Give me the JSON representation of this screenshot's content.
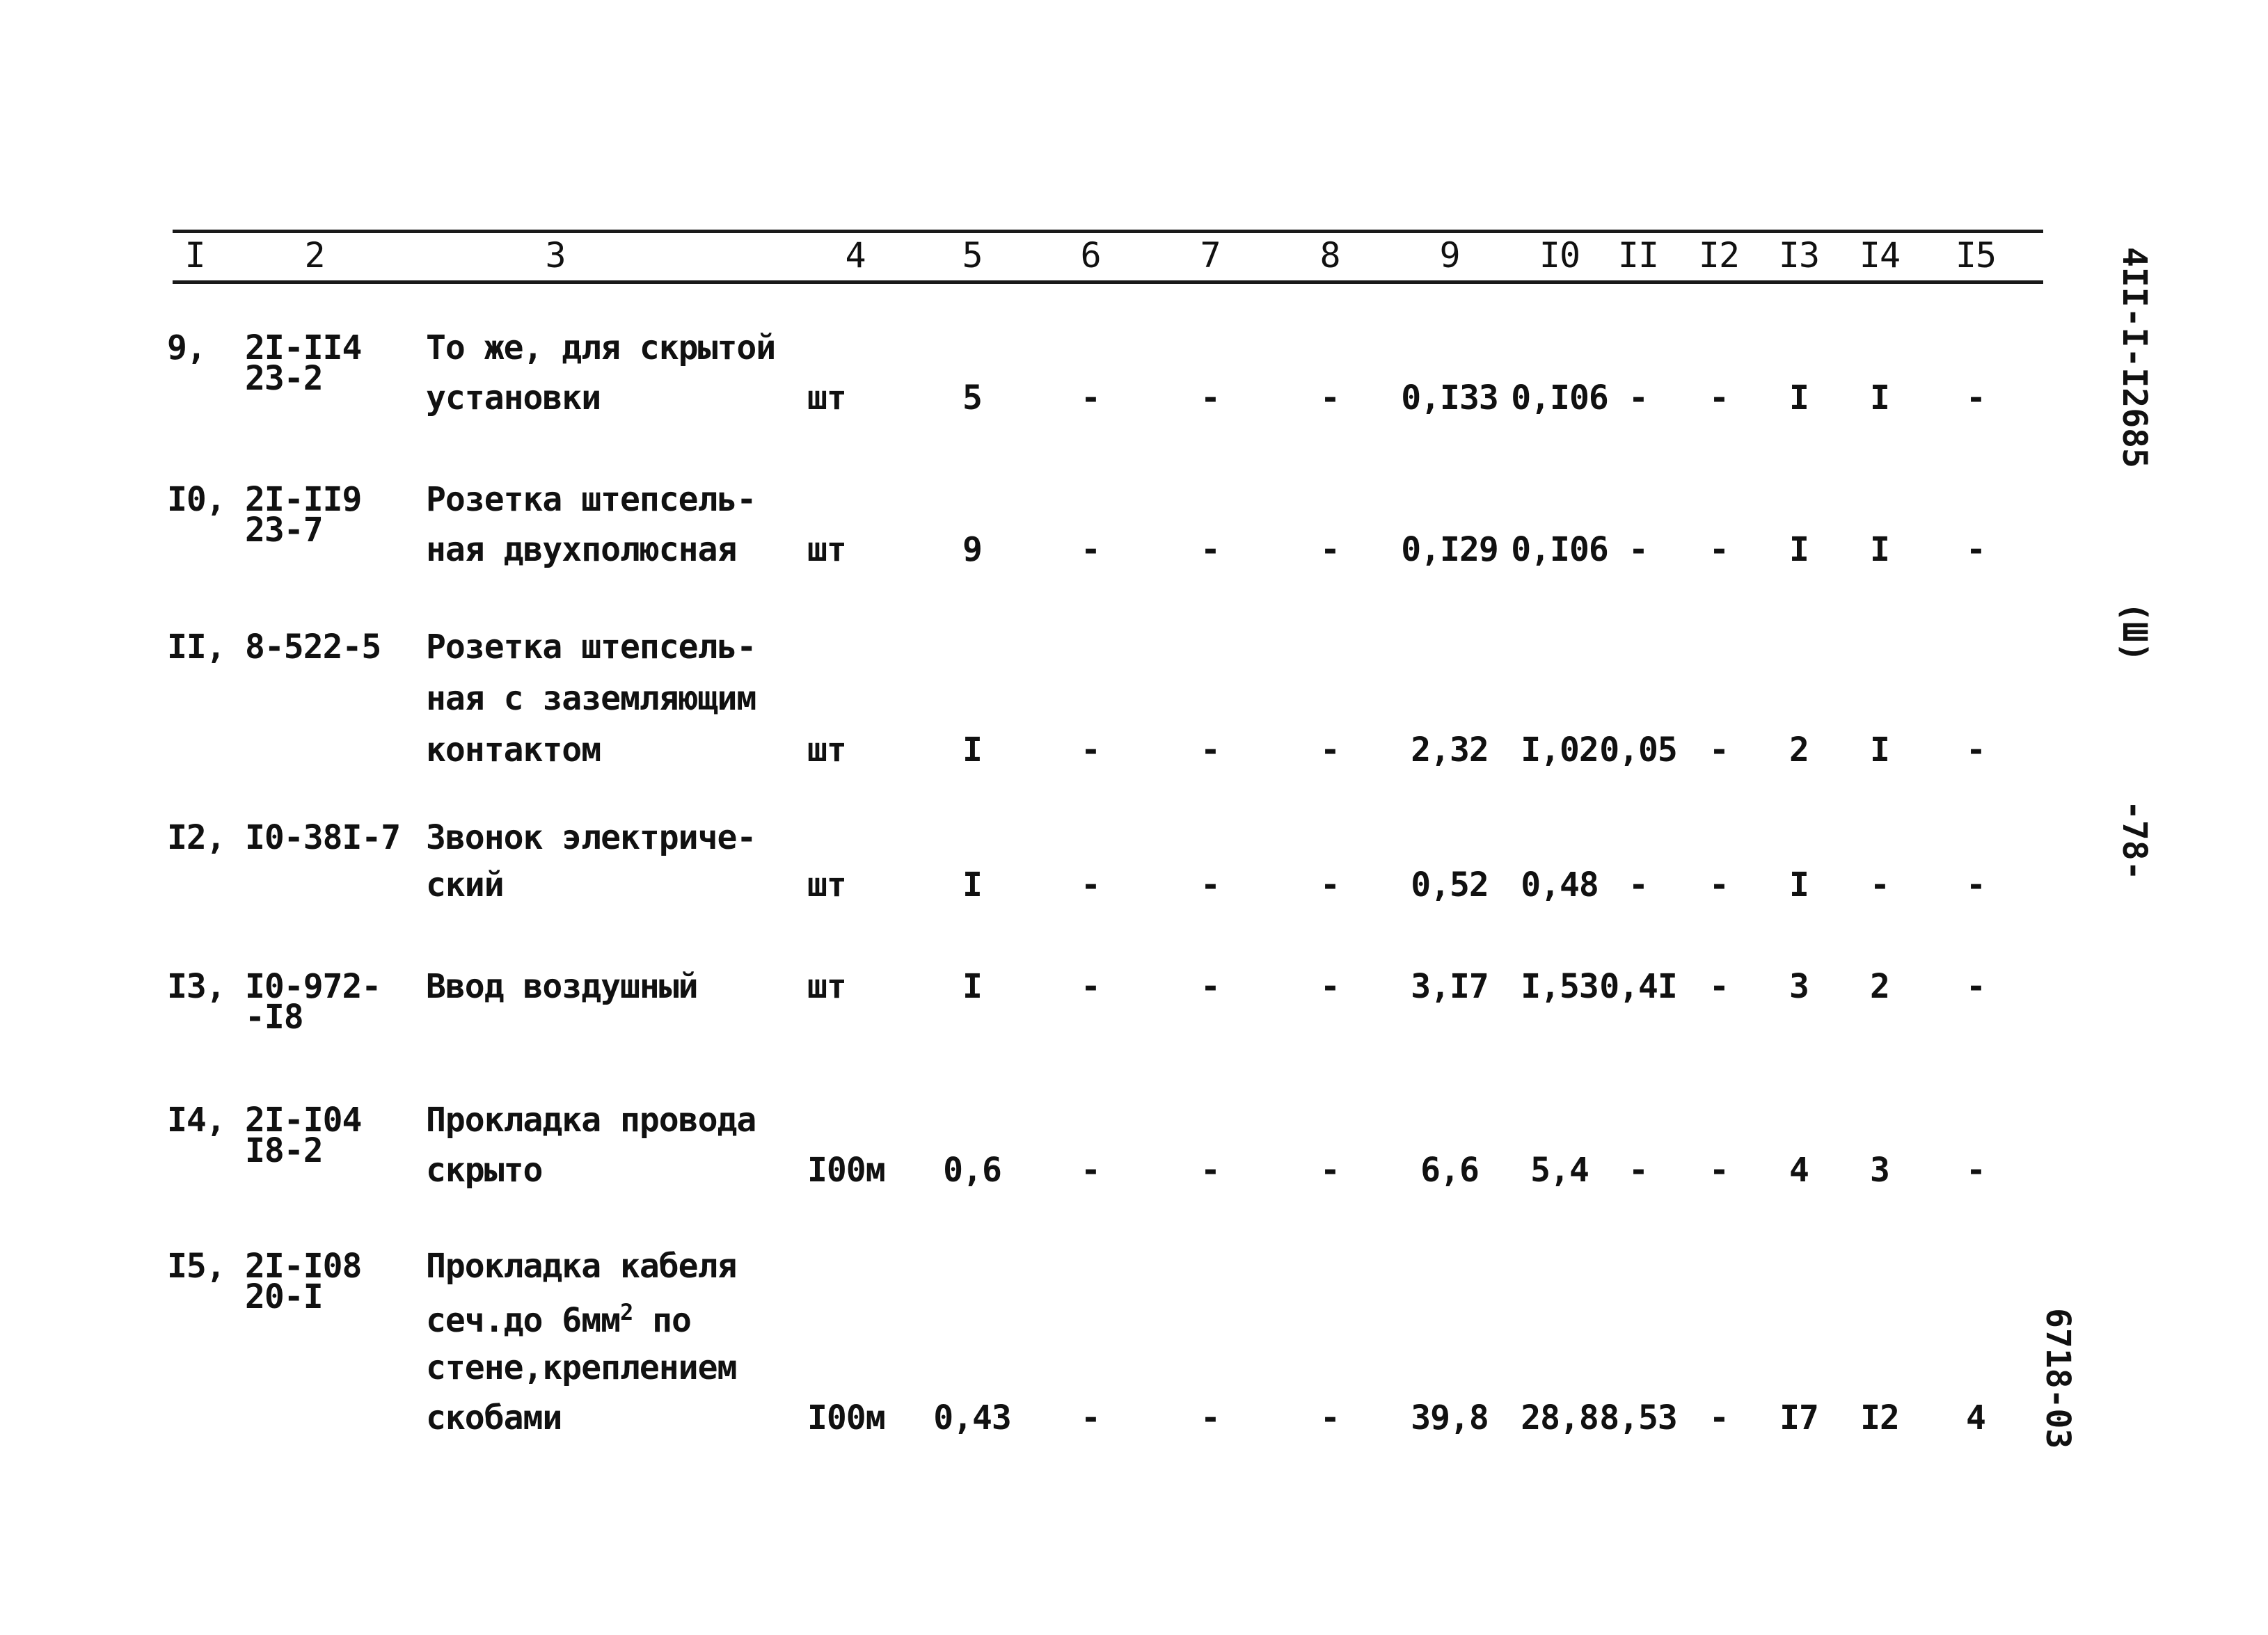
{
  "table": {
    "column_numbers": [
      "I",
      "2",
      "3",
      "4",
      "5",
      "6",
      "7",
      "8",
      "9",
      "I0",
      "II",
      "I2",
      "I3",
      "I4",
      "I5"
    ],
    "rows": [
      {
        "num": "9,",
        "code": [
          "2I-II4",
          "23-2"
        ],
        "desc": [
          "То же, для скрытой",
          "установки"
        ],
        "unit": "шт",
        "c5": "5",
        "c6": "-",
        "c7": "-",
        "c8": "-",
        "c9": "0,I33",
        "c10": "0,I06",
        "c11": "-",
        "c12": "-",
        "c13": "I",
        "c14": "I",
        "c15": "-"
      },
      {
        "num": "I0,",
        "code": [
          "2I-II9",
          "23-7"
        ],
        "desc": [
          "Розетка штепсель-",
          "ная двухполюсная"
        ],
        "unit": "шт",
        "c5": "9",
        "c6": "-",
        "c7": "-",
        "c8": "-",
        "c9": "0,I29",
        "c10": "0,I06",
        "c11": "-",
        "c12": "-",
        "c13": "I",
        "c14": "I",
        "c15": "-"
      },
      {
        "num": "II,",
        "code": [
          "8-522-5"
        ],
        "desc": [
          "Розетка штепсель-",
          "ная с заземляющим",
          "контактом"
        ],
        "unit": "шт",
        "c5": "I",
        "c6": "-",
        "c7": "-",
        "c8": "-",
        "c9": "2,32",
        "c10": "I,02",
        "c11": "0,05",
        "c12": "-",
        "c13": "2",
        "c14": "I",
        "c15": "-"
      },
      {
        "num": "I2,",
        "code": [
          "I0-38I-7"
        ],
        "desc": [
          "Звонок электриче-",
          "ский"
        ],
        "unit": "шт",
        "c5": "I",
        "c6": "-",
        "c7": "-",
        "c8": "-",
        "c9": "0,52",
        "c10": "0,48",
        "c11": "-",
        "c12": "-",
        "c13": "I",
        "c14": "-",
        "c15": "-"
      },
      {
        "num": "I3,",
        "code": [
          "I0-972-",
          "-I8"
        ],
        "desc": [
          "Ввод воздушный"
        ],
        "unit": "шт",
        "c5": "I",
        "c6": "-",
        "c7": "-",
        "c8": "-",
        "c9": "3,I7",
        "c10": "I,53",
        "c11": "0,4I",
        "c12": "-",
        "c13": "3",
        "c14": "2",
        "c15": "-"
      },
      {
        "num": "I4,",
        "code": [
          "2I-I04",
          "I8-2"
        ],
        "desc": [
          "Прокладка провода",
          "скрыто"
        ],
        "unit": "I00м",
        "c5": "0,6",
        "c6": "-",
        "c7": "-",
        "c8": "-",
        "c9": "6,6",
        "c10": "5,4",
        "c11": "-",
        "c12": "-",
        "c13": "4",
        "c14": "3",
        "c15": "-"
      },
      {
        "num": "I5,",
        "code": [
          "2I-I08",
          "20-I"
        ],
        "desc": [
          "Прокладка кабеля",
          "сеч.до 6мм",
          "стене,креплением",
          "скобами"
        ],
        "desc_sup": "2",
        "desc_after_sup": " по",
        "unit": "I00м",
        "c5": "0,43",
        "c6": "-",
        "c7": "-",
        "c8": "-",
        "c9": "39,8",
        "c10": "28,8",
        "c11": "8,53",
        "c12": "-",
        "c13": "I7",
        "c14": "I2",
        "c15": "4"
      }
    ]
  },
  "margin": {
    "doc_code": "4II-I-I2685",
    "mark": "(Ш)",
    "page_number": "-78-",
    "inventory": "6718-03"
  }
}
